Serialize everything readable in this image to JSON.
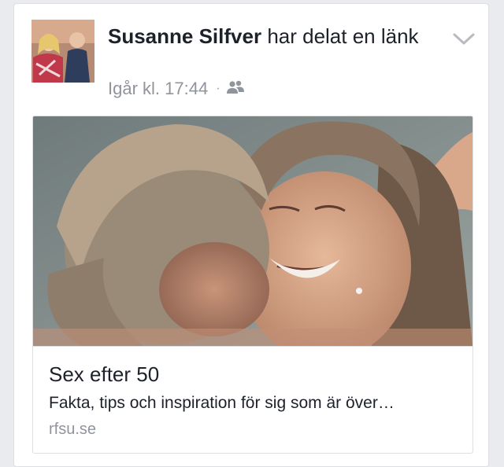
{
  "post": {
    "author": "Susanne Silfver",
    "action": "har delat en länk",
    "timestamp": "Igår kl. 17:44",
    "separator": "·",
    "audience_icon": "friends-icon",
    "menu_icon": "chevron-down-icon"
  },
  "link": {
    "title": "Sex efter 50",
    "description": "Fakta, tips och inspiration för sig som är över…",
    "domain": "rfsu.se"
  },
  "colors": {
    "text": "#1d2129",
    "secondary": "#90949c",
    "border": "#dddfe2",
    "background": "#e9ebee"
  }
}
